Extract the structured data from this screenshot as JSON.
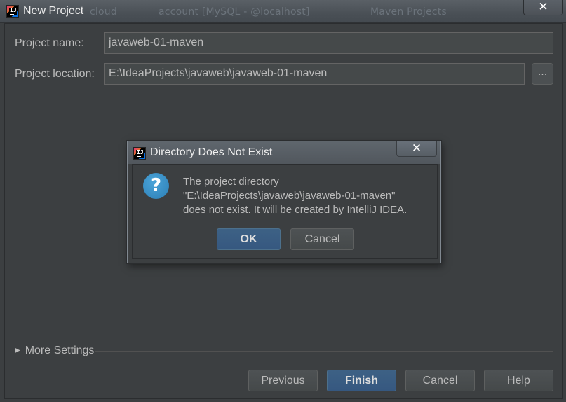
{
  "window": {
    "title": "New Project",
    "close_symbol": "✕",
    "background_ghost": [
      "cloud",
      "account [MySQL - @localhost]",
      "Maven Projects"
    ]
  },
  "form": {
    "project_name_label": "Project name:",
    "project_name_value": "javaweb-01-maven",
    "project_location_label": "Project location:",
    "project_location_value": "E:\\IdeaProjects\\javaweb\\javaweb-01-maven",
    "browse_label": "..."
  },
  "more_settings": {
    "arrow": "▶",
    "label": "More Settings"
  },
  "footer": {
    "previous": "Previous",
    "finish": "Finish",
    "cancel": "Cancel",
    "help": "Help"
  },
  "dialog": {
    "title": "Directory Does Not Exist",
    "close_symbol": "✕",
    "icon_glyph": "?",
    "message_line1": "The project directory",
    "message_line2": "\"E:\\IdeaProjects\\javaweb\\javaweb-01-maven\"",
    "message_line3": "does not exist. It will be created by IntelliJ IDEA.",
    "ok": "OK",
    "cancel": "Cancel"
  },
  "icons": {
    "app": "intellij-idea-icon",
    "question": "question-icon",
    "close": "close-icon",
    "expand": "triangle-right-icon"
  },
  "colors": {
    "background": "#3c3f41",
    "primary_button": "#365880",
    "field_background": "#45494a",
    "text": "#bbbbbb",
    "question_icon": "#2c7fb6"
  }
}
